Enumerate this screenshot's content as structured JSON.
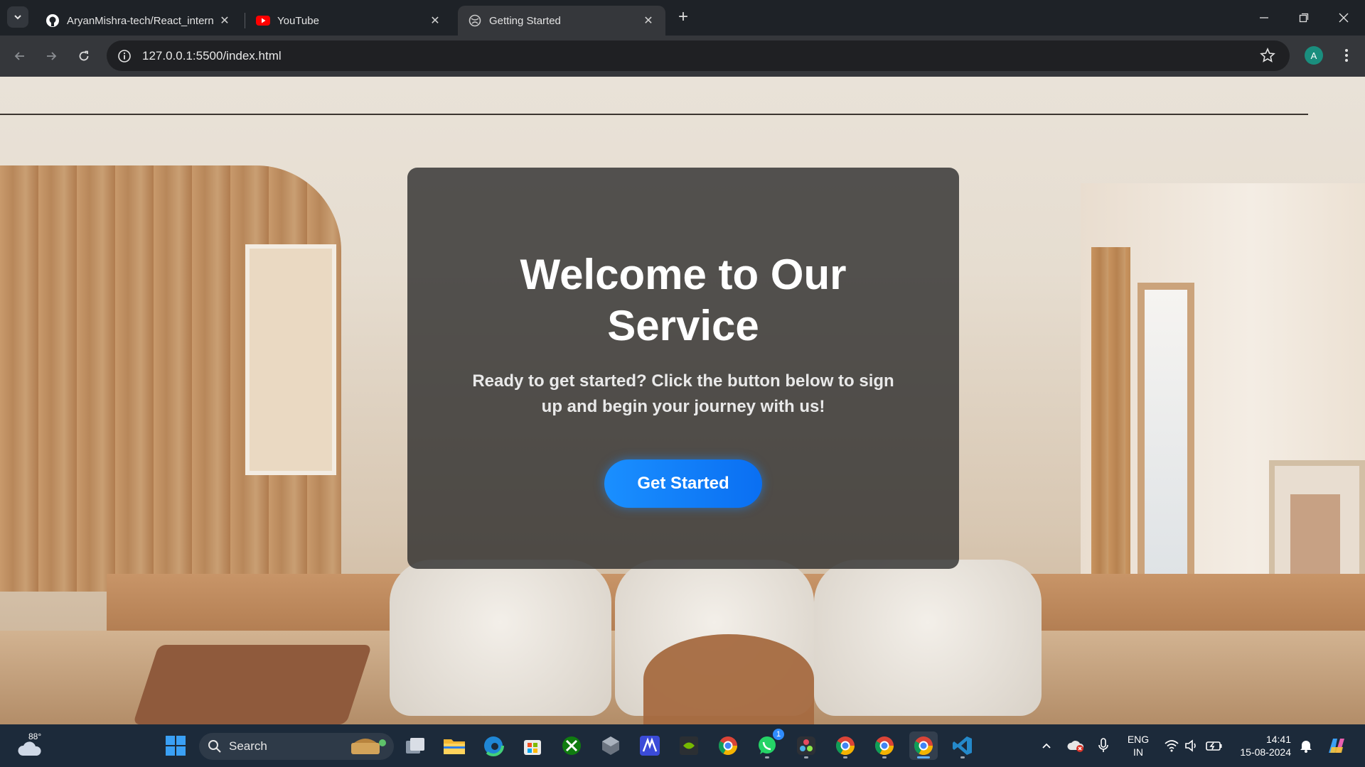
{
  "browser": {
    "tabs": [
      {
        "title": "AryanMishra-tech/React_intern",
        "favicon": "github-icon",
        "active": false
      },
      {
        "title": "YouTube",
        "favicon": "youtube-icon",
        "active": false
      },
      {
        "title": "Getting Started",
        "favicon": "globe-icon",
        "active": true
      }
    ],
    "address": "127.0.0.1:5500/index.html",
    "profile_initial": "A"
  },
  "page": {
    "heading": "Welcome to Our Service",
    "description": "Ready to get started? Click the button below to sign up and begin your journey with us!",
    "cta_label": "Get Started",
    "accent": "#0a7df7"
  },
  "taskbar": {
    "weather_temp": "88°",
    "search_label": "Search",
    "whatsapp_badge": "1",
    "lang_line1": "ENG",
    "lang_line2": "IN",
    "time": "14:41",
    "date": "15-08-2024"
  }
}
